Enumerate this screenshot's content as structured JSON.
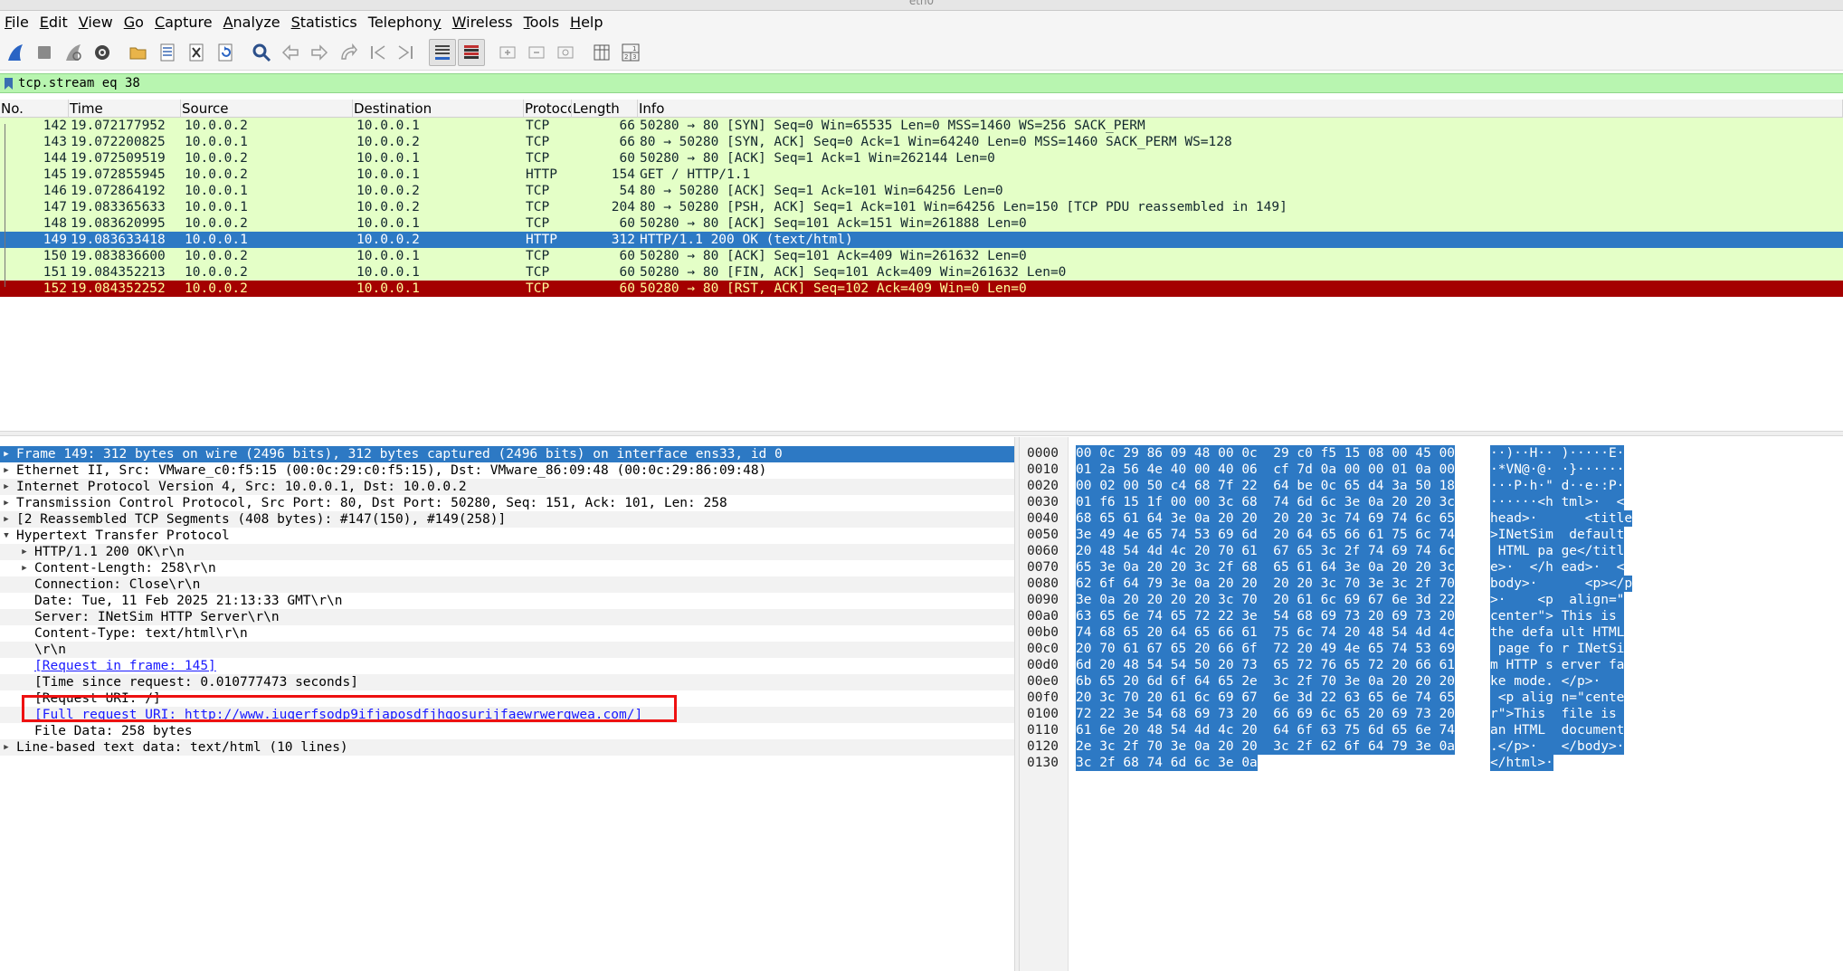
{
  "window": {
    "title": "eth0"
  },
  "menu": [
    {
      "label": "File",
      "mn": "F",
      "rest": "ile"
    },
    {
      "label": "Edit",
      "mn": "E",
      "rest": "dit"
    },
    {
      "label": "View",
      "mn": "V",
      "rest": "iew"
    },
    {
      "label": "Go",
      "mn": "G",
      "rest": "o"
    },
    {
      "label": "Capture",
      "mn": "C",
      "rest": "apture"
    },
    {
      "label": "Analyze",
      "mn": "A",
      "rest": "nalyze"
    },
    {
      "label": "Statistics",
      "mn": "S",
      "rest": "tatistics"
    },
    {
      "label": "Telephony",
      "mn": "y",
      "pre": "Telephon",
      "rest": ""
    },
    {
      "label": "Wireless",
      "mn": "W",
      "rest": "ireless"
    },
    {
      "label": "Tools",
      "mn": "T",
      "rest": "ools"
    },
    {
      "label": "Help",
      "mn": "H",
      "rest": "elp"
    }
  ],
  "toolbar": [
    {
      "name": "start-capture-icon"
    },
    {
      "name": "stop-capture-icon"
    },
    {
      "name": "restart-capture-icon"
    },
    {
      "name": "capture-options-icon"
    },
    {
      "name": "open-file-icon"
    },
    {
      "name": "save-file-icon"
    },
    {
      "name": "close-file-icon"
    },
    {
      "name": "reload-file-icon"
    },
    {
      "name": "find-packet-icon"
    },
    {
      "name": "go-back-icon"
    },
    {
      "name": "go-forward-icon"
    },
    {
      "name": "go-to-packet-icon"
    },
    {
      "name": "first-packet-icon"
    },
    {
      "name": "last-packet-icon"
    },
    {
      "name": "autoscroll-icon"
    },
    {
      "name": "colorize-icon"
    },
    {
      "name": "zoom-in-icon"
    },
    {
      "name": "zoom-out-icon"
    },
    {
      "name": "normal-size-icon"
    },
    {
      "name": "resize-columns-icon"
    },
    {
      "name": "layout-icon"
    }
  ],
  "filter": {
    "value": "tcp.stream eq 38"
  },
  "columns": [
    "No.",
    "Time",
    "Source",
    "Destination",
    "Protocol",
    "Length",
    "Info"
  ],
  "packets": [
    {
      "no": "142",
      "time": "19.072177952",
      "src": "10.0.0.2",
      "dst": "10.0.0.1",
      "proto": "TCP",
      "len": "66",
      "info": "50280 → 80 [SYN] Seq=0 Win=65535 Len=0 MSS=1460 WS=256 SACK_PERM",
      "style": "normal"
    },
    {
      "no": "143",
      "time": "19.072200825",
      "src": "10.0.0.1",
      "dst": "10.0.0.2",
      "proto": "TCP",
      "len": "66",
      "info": "80 → 50280 [SYN, ACK] Seq=0 Ack=1 Win=64240 Len=0 MSS=1460 SACK_PERM WS=128",
      "style": "normal"
    },
    {
      "no": "144",
      "time": "19.072509519",
      "src": "10.0.0.2",
      "dst": "10.0.0.1",
      "proto": "TCP",
      "len": "60",
      "info": "50280 → 80 [ACK] Seq=1 Ack=1 Win=262144 Len=0",
      "style": "normal"
    },
    {
      "no": "145",
      "time": "19.072855945",
      "src": "10.0.0.2",
      "dst": "10.0.0.1",
      "proto": "HTTP",
      "len": "154",
      "info": "GET / HTTP/1.1",
      "style": "normal"
    },
    {
      "no": "146",
      "time": "19.072864192",
      "src": "10.0.0.1",
      "dst": "10.0.0.2",
      "proto": "TCP",
      "len": "54",
      "info": "80 → 50280 [ACK] Seq=1 Ack=101 Win=64256 Len=0",
      "style": "normal"
    },
    {
      "no": "147",
      "time": "19.083365633",
      "src": "10.0.0.1",
      "dst": "10.0.0.2",
      "proto": "TCP",
      "len": "204",
      "info": "80 → 50280 [PSH, ACK] Seq=1 Ack=101 Win=64256 Len=150 [TCP PDU reassembled in 149]",
      "style": "normal"
    },
    {
      "no": "148",
      "time": "19.083620995",
      "src": "10.0.0.2",
      "dst": "10.0.0.1",
      "proto": "TCP",
      "len": "60",
      "info": "50280 → 80 [ACK] Seq=101 Ack=151 Win=261888 Len=0",
      "style": "normal"
    },
    {
      "no": "149",
      "time": "19.083633418",
      "src": "10.0.0.1",
      "dst": "10.0.0.2",
      "proto": "HTTP",
      "len": "312",
      "info": "HTTP/1.1 200 OK  (text/html)",
      "style": "selected"
    },
    {
      "no": "150",
      "time": "19.083836600",
      "src": "10.0.0.2",
      "dst": "10.0.0.1",
      "proto": "TCP",
      "len": "60",
      "info": "50280 → 80 [ACK] Seq=101 Ack=409 Win=261632 Len=0",
      "style": "normal"
    },
    {
      "no": "151",
      "time": "19.084352213",
      "src": "10.0.0.2",
      "dst": "10.0.0.1",
      "proto": "TCP",
      "len": "60",
      "info": "50280 → 80 [FIN, ACK] Seq=101 Ack=409 Win=261632 Len=0",
      "style": "normal"
    },
    {
      "no": "152",
      "time": "19.084352252",
      "src": "10.0.0.2",
      "dst": "10.0.0.1",
      "proto": "TCP",
      "len": "60",
      "info": "50280 → 80 [RST, ACK] Seq=102 Ack=409 Win=0 Len=0",
      "style": "rst"
    }
  ],
  "details": [
    {
      "text": "Frame 149: 312 bytes on wire (2496 bits), 312 bytes captured (2496 bits) on interface ens33, id 0",
      "level": 0,
      "arrow": "right",
      "style": "sel"
    },
    {
      "text": "Ethernet II, Src: VMware_c0:f5:15 (00:0c:29:c0:f5:15), Dst: VMware_86:09:48 (00:0c:29:86:09:48)",
      "level": 0,
      "arrow": "right",
      "style": ""
    },
    {
      "text": "Internet Protocol Version 4, Src: 10.0.0.1, Dst: 10.0.0.2",
      "level": 0,
      "arrow": "right",
      "style": "alt"
    },
    {
      "text": "Transmission Control Protocol, Src Port: 80, Dst Port: 50280, Seq: 151, Ack: 101, Len: 258",
      "level": 0,
      "arrow": "right",
      "style": ""
    },
    {
      "text": "[2 Reassembled TCP Segments (408 bytes): #147(150), #149(258)]",
      "level": 0,
      "arrow": "right",
      "style": "alt"
    },
    {
      "text": "Hypertext Transfer Protocol",
      "level": 0,
      "arrow": "down",
      "style": ""
    },
    {
      "text": "HTTP/1.1 200 OK\\r\\n",
      "level": 1,
      "arrow": "right",
      "style": "alt"
    },
    {
      "text": "Content-Length: 258\\r\\n",
      "level": 1,
      "arrow": "right",
      "style": ""
    },
    {
      "text": "Connection: Close\\r\\n",
      "level": 1,
      "arrow": "",
      "style": "alt"
    },
    {
      "text": "Date: Tue, 11 Feb 2025 21:13:33 GMT\\r\\n",
      "level": 1,
      "arrow": "",
      "style": ""
    },
    {
      "text": "Server: INetSim HTTP Server\\r\\n",
      "level": 1,
      "arrow": "",
      "style": "alt"
    },
    {
      "text": "Content-Type: text/html\\r\\n",
      "level": 1,
      "arrow": "",
      "style": ""
    },
    {
      "text": "\\r\\n",
      "level": 1,
      "arrow": "",
      "style": "alt"
    },
    {
      "text": "[Request in frame: 145]",
      "level": 1,
      "arrow": "",
      "style": "",
      "link": true
    },
    {
      "text": "[Time since request: 0.010777473 seconds]",
      "level": 1,
      "arrow": "",
      "style": "alt"
    },
    {
      "text": "[Request URI: /]",
      "level": 1,
      "arrow": "",
      "style": ""
    },
    {
      "text": "[Full request URI: http://www.iuqerfsodp9ifjaposdfjhgosurijfaewrwergwea.com/]",
      "level": 1,
      "arrow": "",
      "style": "alt",
      "link": true
    },
    {
      "text": "File Data: 258 bytes",
      "level": 1,
      "arrow": "",
      "style": ""
    },
    {
      "text": "Line-based text data: text/html (10 lines)",
      "level": 0,
      "arrow": "right",
      "style": "alt"
    }
  ],
  "bytes": [
    {
      "off": "0000",
      "hex": "00 0c 29 86 09 48 00 0c  29 c0 f5 15 08 00 45 00",
      "ascii": "··)··H·· )·····E·"
    },
    {
      "off": "0010",
      "hex": "01 2a 56 4e 40 00 40 06  cf 7d 0a 00 00 01 0a 00",
      "ascii": "·*VN@·@· ·}······"
    },
    {
      "off": "0020",
      "hex": "00 02 00 50 c4 68 7f 22  64 be 0c 65 d4 3a 50 18",
      "ascii": "···P·h·\" d··e·:P·"
    },
    {
      "off": "0030",
      "hex": "01 f6 15 1f 00 00 3c 68  74 6d 6c 3e 0a 20 20 3c",
      "ascii": "······<h tml>·  <"
    },
    {
      "off": "0040",
      "hex": "68 65 61 64 3e 0a 20 20  20 20 3c 74 69 74 6c 65",
      "ascii": "head>·      <title"
    },
    {
      "off": "0050",
      "hex": "3e 49 4e 65 74 53 69 6d  20 64 65 66 61 75 6c 74",
      "ascii": ">INetSim  default"
    },
    {
      "off": "0060",
      "hex": "20 48 54 4d 4c 20 70 61  67 65 3c 2f 74 69 74 6c",
      "ascii": " HTML pa ge</titl"
    },
    {
      "off": "0070",
      "hex": "65 3e 0a 20 20 3c 2f 68  65 61 64 3e 0a 20 20 3c",
      "ascii": "e>·  </h ead>·  <"
    },
    {
      "off": "0080",
      "hex": "62 6f 64 79 3e 0a 20 20  20 20 3c 70 3e 3c 2f 70",
      "ascii": "body>·      <p></p"
    },
    {
      "off": "0090",
      "hex": "3e 0a 20 20 20 20 3c 70  20 61 6c 69 67 6e 3d 22",
      "ascii": ">·    <p  align=\""
    },
    {
      "off": "00a0",
      "hex": "63 65 6e 74 65 72 22 3e  54 68 69 73 20 69 73 20",
      "ascii": "center\"> This is "
    },
    {
      "off": "00b0",
      "hex": "74 68 65 20 64 65 66 61  75 6c 74 20 48 54 4d 4c",
      "ascii": "the defa ult HTML"
    },
    {
      "off": "00c0",
      "hex": "20 70 61 67 65 20 66 6f  72 20 49 4e 65 74 53 69",
      "ascii": " page fo r INetSi"
    },
    {
      "off": "00d0",
      "hex": "6d 20 48 54 54 50 20 73  65 72 76 65 72 20 66 61",
      "ascii": "m HTTP s erver fa"
    },
    {
      "off": "00e0",
      "hex": "6b 65 20 6d 6f 64 65 2e  3c 2f 70 3e 0a 20 20 20",
      "ascii": "ke mode. </p>·   "
    },
    {
      "off": "00f0",
      "hex": "20 3c 70 20 61 6c 69 67  6e 3d 22 63 65 6e 74 65",
      "ascii": " <p alig n=\"cente"
    },
    {
      "off": "0100",
      "hex": "72 22 3e 54 68 69 73 20  66 69 6c 65 20 69 73 20",
      "ascii": "r\">This  file is "
    },
    {
      "off": "0110",
      "hex": "61 6e 20 48 54 4d 4c 20  64 6f 63 75 6d 65 6e 74",
      "ascii": "an HTML  document"
    },
    {
      "off": "0120",
      "hex": "2e 3c 2f 70 3e 0a 20 20  3c 2f 62 6f 64 79 3e 0a",
      "ascii": ".</p>·   </body>·"
    },
    {
      "off": "0130",
      "hex": "3c 2f 68 74 6d 6c 3e 0a",
      "ascii": "</html>·"
    }
  ]
}
